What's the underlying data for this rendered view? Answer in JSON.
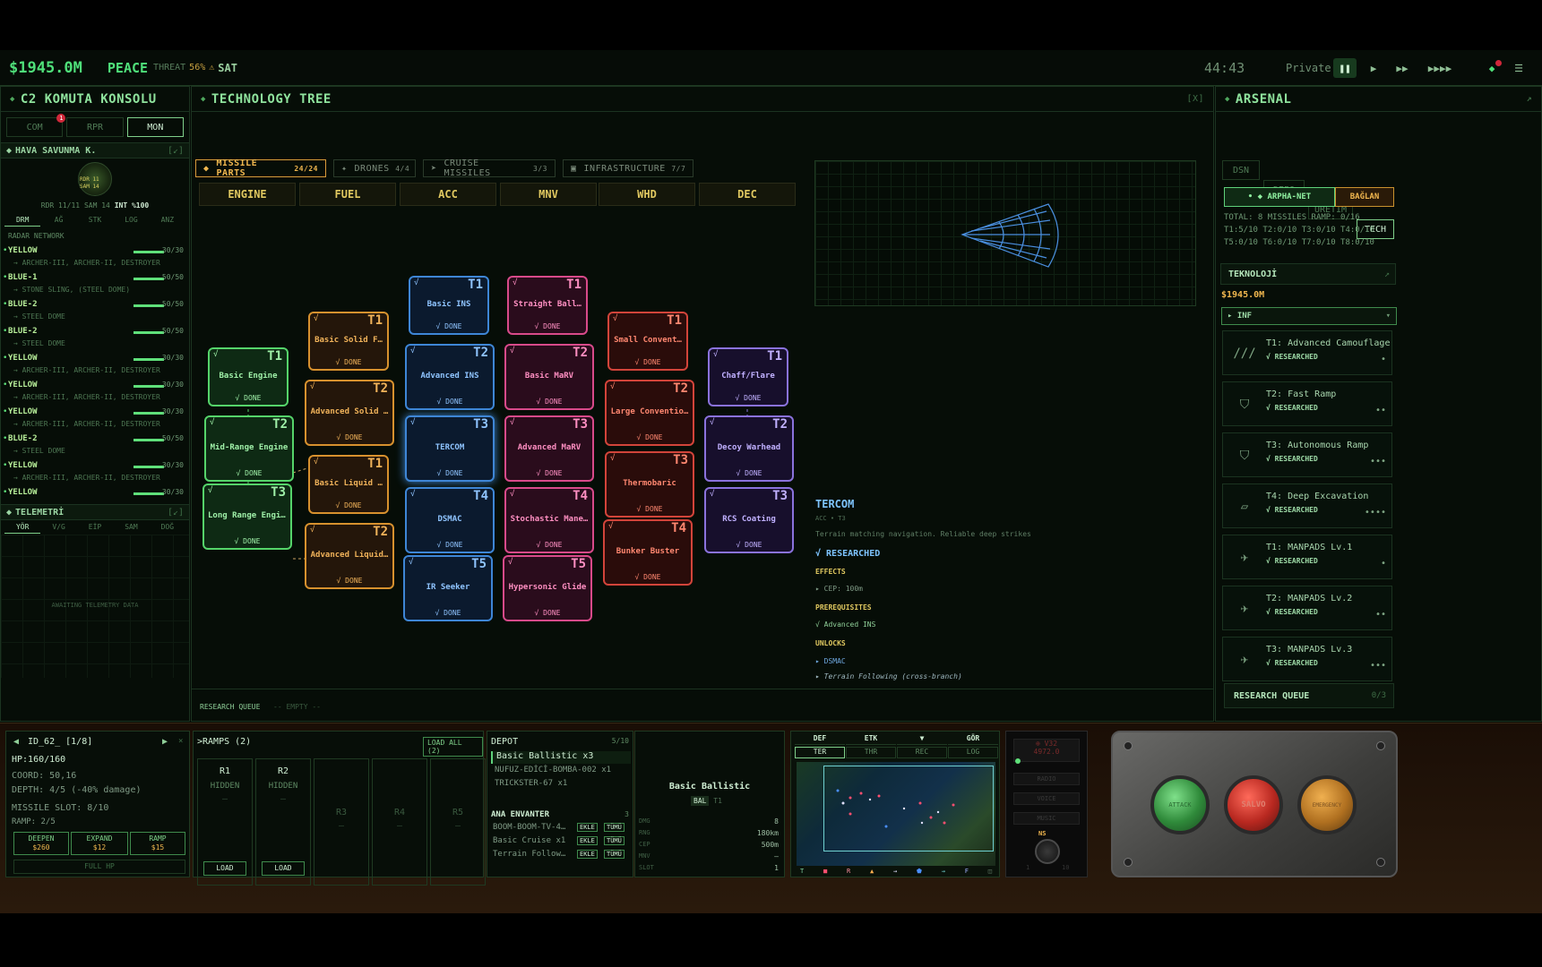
{
  "topbar": {
    "money": "$1945.0M",
    "status": "PEACE",
    "threat_label": "THREAT",
    "threat_pct": "56%",
    "warn": "⚠",
    "day": "SAT",
    "time": "44:43",
    "mode": "Private"
  },
  "left": {
    "title": "C2 KOMUTA KONSOLU",
    "tabs": [
      "COM",
      "RPR",
      "MON"
    ],
    "active_tab": "MON",
    "com_badge": "1",
    "section1": "HAVA SAVUNMA K.",
    "section1_icon": "[↙]",
    "radar_stats": {
      "rdr": "RDR 11/11",
      "sam": "SAM 14",
      "int": "INT %100"
    },
    "radar_labels": {
      "rdr": "RDR 11",
      "sam": "SAM 14"
    },
    "subtabs": [
      "DRM",
      "AĞ",
      "STK",
      "LOG",
      "ANZ"
    ],
    "radar_title": "RADAR NETWORK",
    "radars": [
      {
        "name": "YELLOW",
        "count": "30/30",
        "sub": "→ ARCHER-III, ARCHER-II, DESTROYER"
      },
      {
        "name": "BLUE-1",
        "count": "50/50",
        "sub": "→ STONE SLING, (STEEL DOME)"
      },
      {
        "name": "BLUE-2",
        "count": "50/50",
        "sub": "→ STEEL DOME"
      },
      {
        "name": "BLUE-2",
        "count": "50/50",
        "sub": "→ STEEL DOME"
      },
      {
        "name": "YELLOW",
        "count": "30/30",
        "sub": "→ ARCHER-III, ARCHER-II, DESTROYER"
      },
      {
        "name": "YELLOW",
        "count": "30/30",
        "sub": "→ ARCHER-III, ARCHER-II, DESTROYER"
      },
      {
        "name": "YELLOW",
        "count": "30/30",
        "sub": "→ ARCHER-III, ARCHER-II, DESTROYER"
      },
      {
        "name": "BLUE-2",
        "count": "50/50",
        "sub": "→ STEEL DOME"
      },
      {
        "name": "YELLOW",
        "count": "30/30",
        "sub": "→ ARCHER-III, ARCHER-II, DESTROYER"
      },
      {
        "name": "YELLOW",
        "count": "30/30",
        "sub": ""
      }
    ],
    "section2": "TELEMETRİ",
    "section2_icon": "[↙]",
    "tele_tabs": [
      "YÖR",
      "V/G",
      "EİP",
      "SAM",
      "DOĞ"
    ],
    "awaiting": "AWAITING TELEMETRY DATA"
  },
  "tree": {
    "title": "TECHNOLOGY TREE",
    "close": "[X]",
    "tabs": [
      {
        "label": "MISSILE PARTS",
        "count": "24/24",
        "icon": "◆"
      },
      {
        "label": "DRONES",
        "count": "4/4",
        "icon": "✦"
      },
      {
        "label": "CRUISE MISSILES",
        "count": "3/3",
        "icon": "➤"
      },
      {
        "label": "INFRASTRUCTURE",
        "count": "7/7",
        "icon": "▣"
      }
    ],
    "columns": [
      "ENGINE",
      "FUEL",
      "ACC",
      "MNV",
      "WHD",
      "DEC"
    ],
    "check": "√",
    "done": "√ DONE",
    "nodes": [
      {
        "name": "Basic Engine",
        "tier": "T1"
      },
      {
        "name": "Mid-Range Engine",
        "tier": "T2"
      },
      {
        "name": "Long Range Engine",
        "tier": "T3"
      },
      {
        "name": "Basic Solid F…",
        "tier": "T1"
      },
      {
        "name": "Advanced Solid …",
        "tier": "T2"
      },
      {
        "name": "Basic Liquid …",
        "tier": "T1"
      },
      {
        "name": "Advanced Liquid…",
        "tier": "T2"
      },
      {
        "name": "Basic INS",
        "tier": "T1"
      },
      {
        "name": "Advanced INS",
        "tier": "T2"
      },
      {
        "name": "TERCOM",
        "tier": "T3"
      },
      {
        "name": "DSMAC",
        "tier": "T4"
      },
      {
        "name": "IR Seeker",
        "tier": "T5"
      },
      {
        "name": "Straight Ball…",
        "tier": "T1"
      },
      {
        "name": "Basic MaRV",
        "tier": "T2"
      },
      {
        "name": "Advanced MaRV",
        "tier": "T3"
      },
      {
        "name": "Stochastic Mane…",
        "tier": "T4"
      },
      {
        "name": "Hypersonic Glide",
        "tier": "T5"
      },
      {
        "name": "Small Convent…",
        "tier": "T1"
      },
      {
        "name": "Large Conventio…",
        "tier": "T2"
      },
      {
        "name": "Thermobaric",
        "tier": "T3"
      },
      {
        "name": "Bunker Buster",
        "tier": "T4"
      },
      {
        "name": "Chaff/Flare",
        "tier": "T1"
      },
      {
        "name": "Decoy Warhead",
        "tier": "T2"
      },
      {
        "name": "RCS Coating",
        "tier": "T3"
      }
    ],
    "detail": {
      "name": "TERCOM",
      "meta": "ACC • T3",
      "desc": "Terrain matching navigation. Reliable deep strikes",
      "status": "√ RESEARCHED",
      "effects_h": "EFFECTS",
      "effect": "▸ CEP: 100m",
      "prereq_h": "PREREQUISITES",
      "prereq": "√ Advanced INS",
      "unlocks_h": "UNLOCKS",
      "unlock1": "▸ DSMAC",
      "unlock2": "▸ Terrain Following (cross-branch)"
    },
    "queue_label": "RESEARCH QUEUE",
    "queue_empty": "-- EMPTY --"
  },
  "arsenal": {
    "title": "ARSENAL",
    "tabs": [
      "DSN",
      "DEPO",
      "ÜRETİM",
      "TECH"
    ],
    "active_tab": "TECH",
    "net": "• ◆ ARPHA-NET",
    "link": "BAĞLAN",
    "total": "TOTAL: 8 MISSILES RAMP: 0/16",
    "tiers1": "T1:5/10 T2:0/10 T3:0/10 T4:0/10",
    "tiers2": "T5:0/10 T6:0/10 T7:0/10 T8:0/10",
    "tech_title": "TEKNOLOJİ",
    "tech_icon": "↗",
    "money": "$1945.0M",
    "filter": "▸ INF",
    "filter_arrow": "▾",
    "items": [
      {
        "name": "T1: Advanced Camouflage",
        "status": "√ RESEARCHED",
        "dots": "•",
        "icon": "///"
      },
      {
        "name": "T2: Fast Ramp",
        "status": "√ RESEARCHED",
        "dots": "••",
        "icon": "⛉"
      },
      {
        "name": "T3: Autonomous Ramp",
        "status": "√ RESEARCHED",
        "dots": "•••",
        "icon": "⛉"
      },
      {
        "name": "T4: Deep Excavation",
        "status": "√ RESEARCHED",
        "dots": "••••",
        "icon": "▱"
      },
      {
        "name": "T1: MANPADS Lv.1",
        "status": "√ RESEARCHED",
        "dots": "•",
        "icon": "✈"
      },
      {
        "name": "T2: MANPADS Lv.2",
        "status": "√ RESEARCHED",
        "dots": "••",
        "icon": "✈"
      },
      {
        "name": "T3: MANPADS Lv.3",
        "status": "√ RESEARCHED",
        "dots": "•••",
        "icon": "✈"
      }
    ],
    "queue": "RESEARCH QUEUE",
    "queue_count": "0/3"
  },
  "bottom": {
    "site": {
      "id": "ID_62_ [1/8]",
      "hp": "HP:160/160",
      "coord": "COORD: 50,16",
      "depth": "DEPTH: 4/5 (-40% damage)",
      "slot": "MISSILE SLOT: 8/10",
      "ramp": "RAMP: 2/5",
      "deepen": "DEEPEN",
      "deepen_cost": "$260",
      "expand": "EXPAND",
      "expand_cost": "$12",
      "ramp_btn": "RAMP",
      "ramp_cost": "$15",
      "full": "FULL HP"
    },
    "ramps": {
      "title": ">RAMPS (2)",
      "load_all": "LOAD ALL (2)",
      "items": [
        {
          "name": "R1",
          "state": "HIDDEN",
          "dash": "—",
          "btn": "LOAD"
        },
        {
          "name": "R2",
          "state": "HIDDEN",
          "dash": "—",
          "btn": "LOAD"
        },
        {
          "name": "R3",
          "dash": "—"
        },
        {
          "name": "R4",
          "dash": "—"
        },
        {
          "name": "R5",
          "dash": "—"
        }
      ]
    },
    "depot": {
      "title": "DEPOT",
      "count": "5/10",
      "items": [
        "Basic Ballistic x3",
        "NUFUZ-EDİCİ-BOMBA-002 x1",
        "TRICKSTER-67 x1"
      ],
      "inv_title": "ANA ENVANTER",
      "inv_count": "3",
      "inv": [
        {
          "name": "BOOM-BOOM-TV-4…"
        },
        {
          "name": "Basic Cruise x1"
        },
        {
          "name": "Terrain Follow…"
        }
      ],
      "add": "EKLE",
      "all": "TÜMÜ"
    },
    "spec": {
      "name": "Basic Ballistic",
      "tag": "BAL",
      "tier": "T1",
      "rows": [
        {
          "k": "DMG",
          "v": "8"
        },
        {
          "k": "RNG",
          "v": "180km"
        },
        {
          "k": "CEP",
          "v": "500m"
        },
        {
          "k": "MNV",
          "v": "—"
        },
        {
          "k": "SLOT",
          "v": "1"
        }
      ]
    },
    "map": {
      "tabs1": [
        "DEF",
        "ETK",
        "▼",
        "GÖR"
      ],
      "tabs2": [
        "TER",
        "THR",
        "REC",
        "LOG"
      ],
      "legend": [
        "T",
        "■",
        "R",
        "▲",
        "→",
        "⬟",
        "→",
        "F",
        "◫"
      ]
    },
    "radio": {
      "freq": "⊕ V32",
      "freq2": "4972.0",
      "items": [
        "RADIO",
        "VOICE",
        "MUSIC"
      ],
      "knob": "NS",
      "k1": "1",
      "k2": "10"
    },
    "buttons": [
      "ATTACK",
      "SALVO",
      "EMERGENCY"
    ]
  }
}
